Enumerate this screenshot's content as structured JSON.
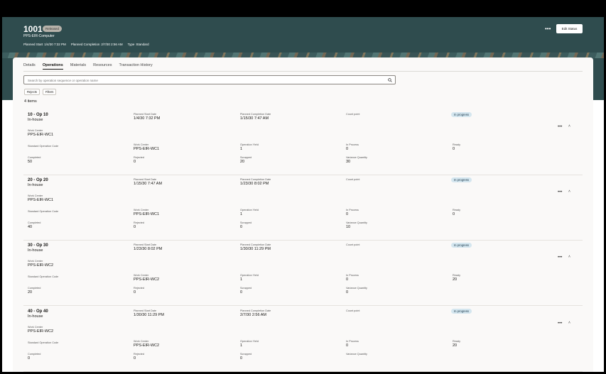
{
  "header": {
    "order_number": "1001",
    "status": "Released",
    "item": "PPS-EIR-Computer",
    "planned_start_label": "Planned Start",
    "planned_start": "1/4/30 7:32 PM",
    "planned_completion_label": "Planned Completion",
    "planned_completion": "2/7/30 2:56 AM",
    "type_label": "Type",
    "type": "Standard",
    "more_label": "•••",
    "edit_status_label": "Edit Status"
  },
  "tabs": [
    "Details",
    "Operations",
    "Materials",
    "Resources",
    "Transaction History"
  ],
  "active_tab": "Operations",
  "search": {
    "placeholder": "Search by operation sequence or operation name"
  },
  "chips": {
    "rejects": "Rejects",
    "filters": "Filters"
  },
  "count_label": "4 items",
  "labels": {
    "planned_start_date": "Planned Start Date",
    "planned_completion_date": "Planned Completion Date",
    "count_point": "Count point",
    "work_center": "Work Center",
    "standard_operation_code": "Standard Operation Code",
    "operation_yield": "Operation Yield",
    "in_process": "In Process",
    "ready": "Ready",
    "completed": "Completed",
    "rejected": "Rejected",
    "scrapped": "Scrapped",
    "variance_quantity": "Variance Quantity"
  },
  "operations": [
    {
      "title": "10 - Op 10",
      "subtitle": "In-house",
      "start": "1/4/30 7:32 PM",
      "completion": "1/15/30 7:47 AM",
      "status": "In progress",
      "work_center": "PPS-EIR-WC1",
      "wc_detail": "PPS-EIR-WC1",
      "yield": "1",
      "in_process": "0",
      "ready": "0",
      "completed": "50",
      "rejected": "0",
      "scrapped": "20",
      "variance": "30"
    },
    {
      "title": "20 - Op 20",
      "subtitle": "In-house",
      "start": "1/15/30 7:47 AM",
      "completion": "1/23/30 8:02 PM",
      "status": "In progress",
      "work_center": "PPS-EIR-WC1",
      "wc_detail": "PPS-EIR-WC1",
      "yield": "1",
      "in_process": "0",
      "ready": "0",
      "completed": "40",
      "rejected": "0",
      "scrapped": "0",
      "variance": "10"
    },
    {
      "title": "30 - Op 30",
      "subtitle": "In-house",
      "start": "1/23/30 8:02 PM",
      "completion": "1/30/30 11:29 PM",
      "status": "In progress",
      "work_center": "PPS-EIR-WC2",
      "wc_detail": "PPS-EIR-WC2",
      "yield": "1",
      "in_process": "0",
      "ready": "20",
      "completed": "20",
      "rejected": "0",
      "scrapped": "0",
      "variance": "0"
    },
    {
      "title": "40 - Op 40",
      "subtitle": "In-house",
      "start": "1/30/30 11:29 PM",
      "completion": "2/7/30 2:56 AM",
      "status": "In progress",
      "work_center": "PPS-EIR-WC2",
      "wc_detail": "PPS-EIR-WC2",
      "yield": "1",
      "in_process": "0",
      "ready": "20",
      "completed": "0",
      "rejected": "0",
      "scrapped": "0",
      "variance": ""
    }
  ],
  "icons": {
    "search": "search-icon",
    "more": "more-actions-icon",
    "collapse": "chevron-up-icon"
  },
  "colors": {
    "header_bg": "#2f4c4e",
    "badge_bg": "#d4e6ef"
  }
}
